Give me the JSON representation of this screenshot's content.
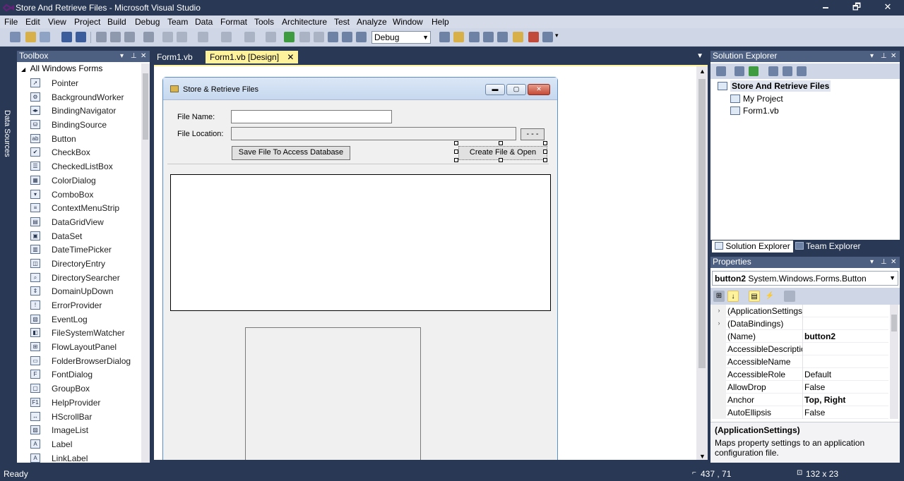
{
  "window": {
    "title": "Store And Retrieve Files - Microsoft Visual Studio",
    "minimize": "🗕",
    "maximize": "🗗",
    "close": "✕"
  },
  "menu": [
    "File",
    "Edit",
    "View",
    "Project",
    "Build",
    "Debug",
    "Team",
    "Data",
    "Format",
    "Tools",
    "Architecture",
    "Test",
    "Analyze",
    "Window",
    "Help"
  ],
  "toolbar": {
    "config": "Debug"
  },
  "side_strip": {
    "label": "Data Sources"
  },
  "toolbox": {
    "title": "Toolbox",
    "category": "All Windows Forms",
    "items": [
      {
        "label": "Pointer",
        "glyph": "➚"
      },
      {
        "label": "BackgroundWorker",
        "glyph": "⚙"
      },
      {
        "label": "BindingNavigator",
        "glyph": "◂▸"
      },
      {
        "label": "BindingSource",
        "glyph": "⛁"
      },
      {
        "label": "Button",
        "glyph": "ab"
      },
      {
        "label": "CheckBox",
        "glyph": "✔"
      },
      {
        "label": "CheckedListBox",
        "glyph": "☰"
      },
      {
        "label": "ColorDialog",
        "glyph": "▦"
      },
      {
        "label": "ComboBox",
        "glyph": "▾"
      },
      {
        "label": "ContextMenuStrip",
        "glyph": "≡"
      },
      {
        "label": "DataGridView",
        "glyph": "▤"
      },
      {
        "label": "DataSet",
        "glyph": "▣"
      },
      {
        "label": "DateTimePicker",
        "glyph": "▥"
      },
      {
        "label": "DirectoryEntry",
        "glyph": "◫"
      },
      {
        "label": "DirectorySearcher",
        "glyph": "⌕"
      },
      {
        "label": "DomainUpDown",
        "glyph": "⇕"
      },
      {
        "label": "ErrorProvider",
        "glyph": "!"
      },
      {
        "label": "EventLog",
        "glyph": "▧"
      },
      {
        "label": "FileSystemWatcher",
        "glyph": "◧"
      },
      {
        "label": "FlowLayoutPanel",
        "glyph": "⊞"
      },
      {
        "label": "FolderBrowserDialog",
        "glyph": "▭"
      },
      {
        "label": "FontDialog",
        "glyph": "F"
      },
      {
        "label": "GroupBox",
        "glyph": "▢"
      },
      {
        "label": "HelpProvider",
        "glyph": "F1"
      },
      {
        "label": "HScrollBar",
        "glyph": "↔"
      },
      {
        "label": "ImageList",
        "glyph": "▨"
      },
      {
        "label": "Label",
        "glyph": "A"
      },
      {
        "label": "LinkLabel",
        "glyph": "A"
      }
    ]
  },
  "doc_tabs": [
    {
      "label": "Form1.vb"
    },
    {
      "label": "Form1.vb [Design]",
      "close": "✕"
    }
  ],
  "form": {
    "title": "Store & Retrieve Files",
    "file_name_label": "File Name:",
    "file_name_value": "",
    "file_location_label": "File Location:",
    "file_location_value": "",
    "browse_button": "- - -",
    "save_button": "Save File To Access Database",
    "create_button": "Create File & Open",
    "min": "▬",
    "max": "▢",
    "close": "✕"
  },
  "solution_explorer": {
    "title": "Solution Explorer",
    "root": "Store And Retrieve Files",
    "children": [
      "My Project",
      "Form1.vb"
    ]
  },
  "se_tabs": [
    "Solution Explorer",
    "Team Explorer"
  ],
  "properties": {
    "title": "Properties",
    "object_name": "button2",
    "object_type": "System.Windows.Forms.Button",
    "rows": [
      {
        "name": "(ApplicationSettings)",
        "value": "",
        "expander": "›"
      },
      {
        "name": "(DataBindings)",
        "value": "",
        "expander": "›"
      },
      {
        "name": "(Name)",
        "value": "button2",
        "bold": true
      },
      {
        "name": "AccessibleDescription",
        "value": ""
      },
      {
        "name": "AccessibleName",
        "value": ""
      },
      {
        "name": "AccessibleRole",
        "value": "Default"
      },
      {
        "name": "AllowDrop",
        "value": "False"
      },
      {
        "name": "Anchor",
        "value": "Top, Right",
        "bold": true
      },
      {
        "name": "AutoEllipsis",
        "value": "False"
      }
    ],
    "desc_title": "(ApplicationSettings)",
    "desc_text": "Maps property settings to an application configuration file."
  },
  "status": {
    "text": "Ready",
    "position": "437 , 71",
    "size": "132 x 23"
  },
  "colors": {
    "chrome": "#293955",
    "active_tab": "#fff29d",
    "panel_header": "#4d6082"
  }
}
